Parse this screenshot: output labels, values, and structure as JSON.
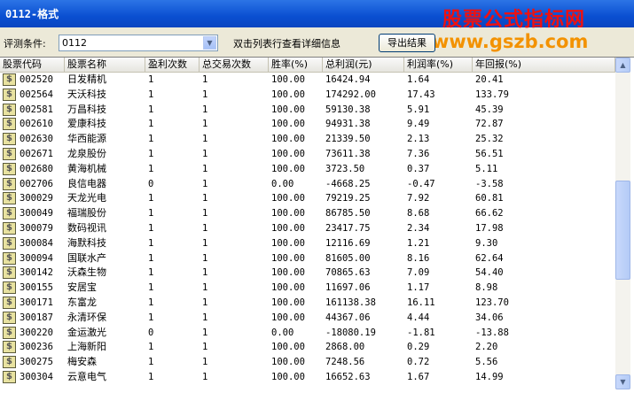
{
  "window": {
    "title": "0112-格式"
  },
  "watermark": {
    "cn": "股票公式指标网",
    "url": "www.gszb.com"
  },
  "filter": {
    "label": "评测条件:",
    "selected": "0112",
    "hint": "双击列表行查看详细信息",
    "export_label": "导出结果"
  },
  "table": {
    "columns": [
      "股票代码",
      "股票名称",
      "盈利次数",
      "总交易次数",
      "胜率(%)",
      "总利润(元)",
      "利润率(%)",
      "年回报(%)"
    ],
    "rows": [
      [
        "002520",
        "日发精机",
        "1",
        "1",
        "100.00",
        "16424.94",
        "1.64",
        "20.41"
      ],
      [
        "002564",
        "天沃科技",
        "1",
        "1",
        "100.00",
        "174292.00",
        "17.43",
        "133.79"
      ],
      [
        "002581",
        "万昌科技",
        "1",
        "1",
        "100.00",
        "59130.38",
        "5.91",
        "45.39"
      ],
      [
        "002610",
        "爱康科技",
        "1",
        "1",
        "100.00",
        "94931.38",
        "9.49",
        "72.87"
      ],
      [
        "002630",
        "华西能源",
        "1",
        "1",
        "100.00",
        "21339.50",
        "2.13",
        "25.32"
      ],
      [
        "002671",
        "龙泉股份",
        "1",
        "1",
        "100.00",
        "73611.38",
        "7.36",
        "56.51"
      ],
      [
        "002680",
        "黄海机械",
        "1",
        "1",
        "100.00",
        "3723.50",
        "0.37",
        "5.11"
      ],
      [
        "002706",
        "良信电器",
        "0",
        "1",
        "0.00",
        "-4668.25",
        "-0.47",
        "-3.58"
      ],
      [
        "300029",
        "天龙光电",
        "1",
        "1",
        "100.00",
        "79219.25",
        "7.92",
        "60.81"
      ],
      [
        "300049",
        "福瑞股份",
        "1",
        "1",
        "100.00",
        "86785.50",
        "8.68",
        "66.62"
      ],
      [
        "300079",
        "数码视讯",
        "1",
        "1",
        "100.00",
        "23417.75",
        "2.34",
        "17.98"
      ],
      [
        "300084",
        "海默科技",
        "1",
        "1",
        "100.00",
        "12116.69",
        "1.21",
        "9.30"
      ],
      [
        "300094",
        "国联水产",
        "1",
        "1",
        "100.00",
        "81605.00",
        "8.16",
        "62.64"
      ],
      [
        "300142",
        "沃森生物",
        "1",
        "1",
        "100.00",
        "70865.63",
        "7.09",
        "54.40"
      ],
      [
        "300155",
        "安居宝",
        "1",
        "1",
        "100.00",
        "11697.06",
        "1.17",
        "8.98"
      ],
      [
        "300171",
        "东富龙",
        "1",
        "1",
        "100.00",
        "161138.38",
        "16.11",
        "123.70"
      ],
      [
        "300187",
        "永清环保",
        "1",
        "1",
        "100.00",
        "44367.06",
        "4.44",
        "34.06"
      ],
      [
        "300220",
        "金运激光",
        "0",
        "1",
        "0.00",
        "-18080.19",
        "-1.81",
        "-13.88"
      ],
      [
        "300236",
        "上海新阳",
        "1",
        "1",
        "100.00",
        "2868.00",
        "0.29",
        "2.20"
      ],
      [
        "300275",
        "梅安森",
        "1",
        "1",
        "100.00",
        "7248.56",
        "0.72",
        "5.56"
      ],
      [
        "300304",
        "云意电气",
        "1",
        "1",
        "100.00",
        "16652.63",
        "1.67",
        "14.99"
      ]
    ],
    "row_icon": "dollar-sign-icon"
  },
  "scrollbar": {
    "up_icon": "arrow-up-icon",
    "down_icon": "arrow-down-icon"
  }
}
